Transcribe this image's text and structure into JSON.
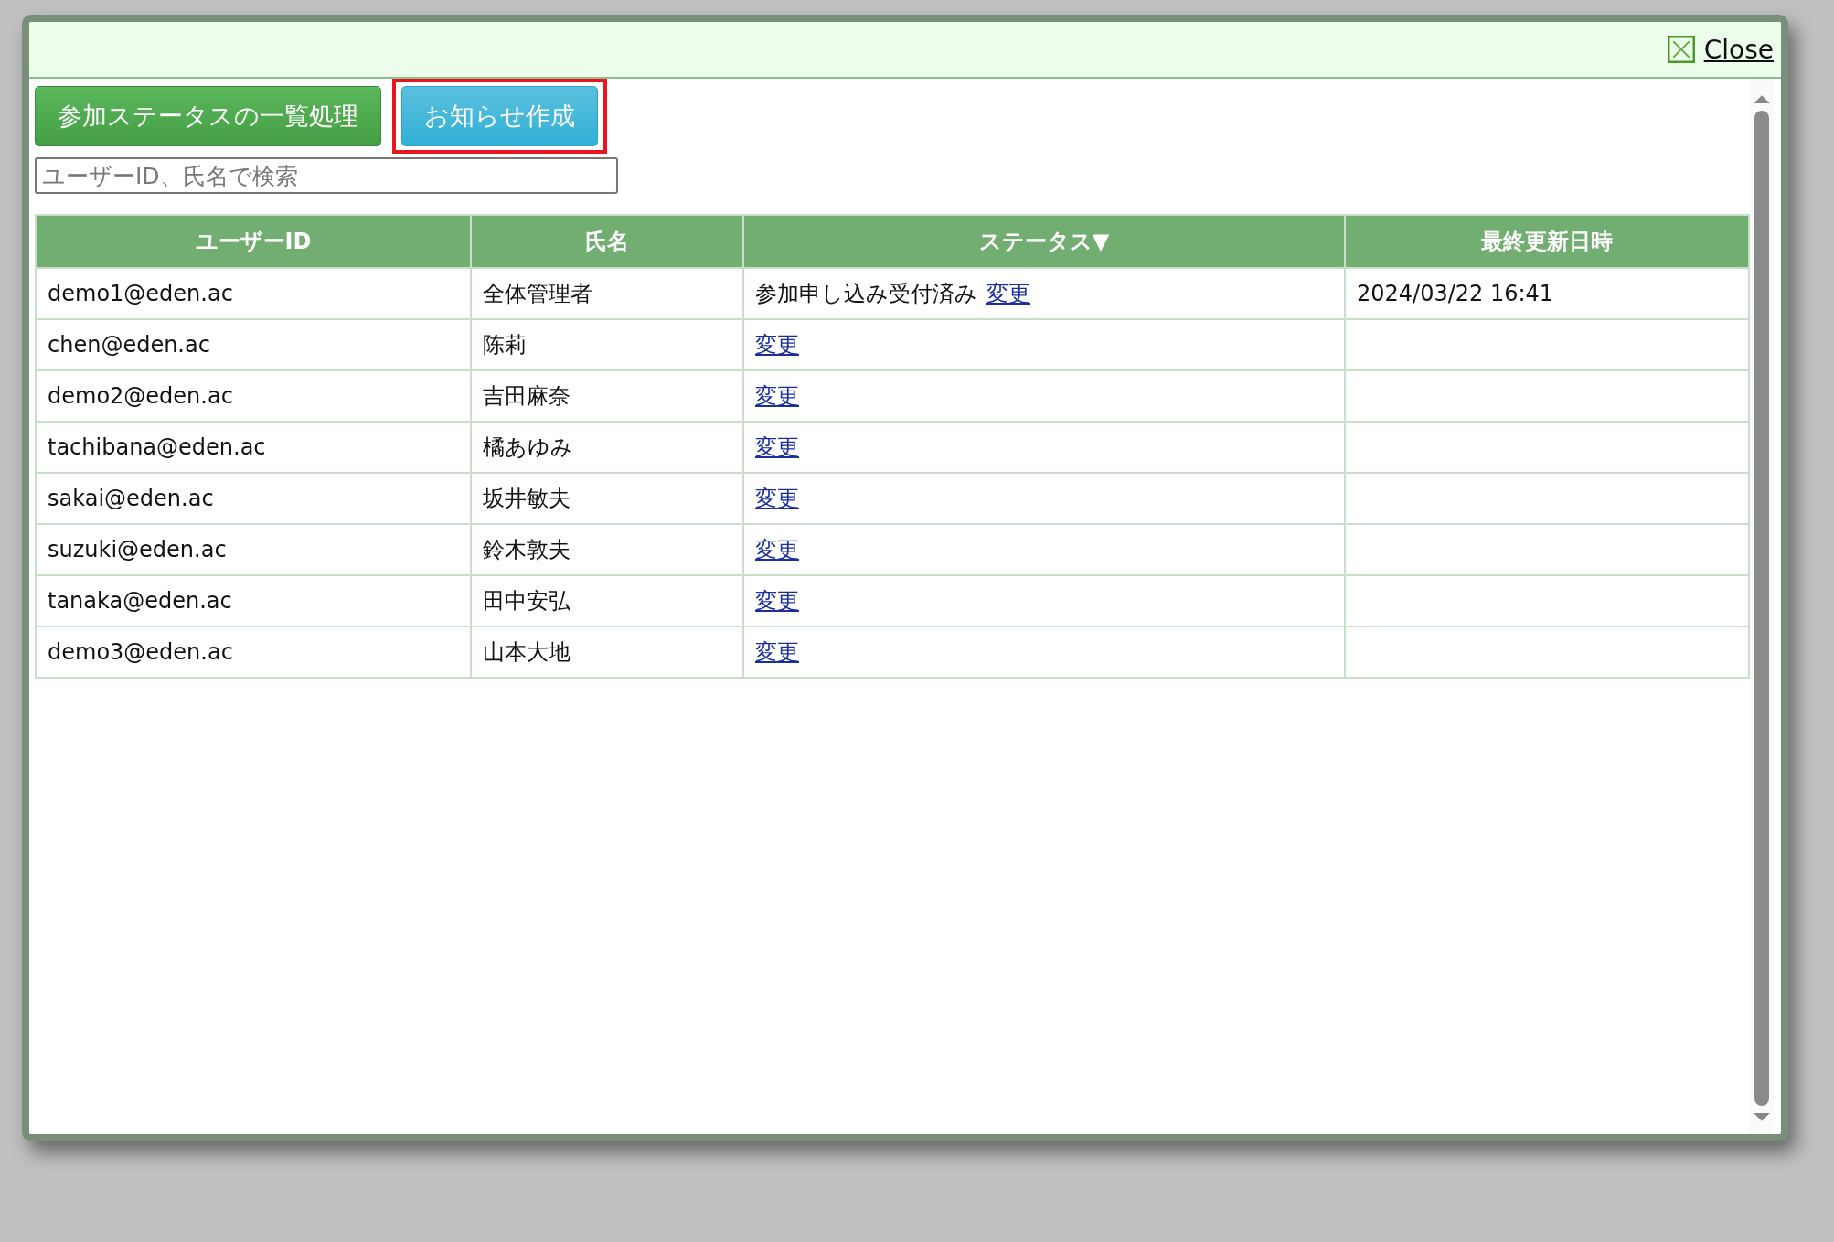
{
  "dialog": {
    "close_label": "Close"
  },
  "toolbar": {
    "buttons": [
      {
        "label": "参加ステータスの一覧処理",
        "kind": "primary",
        "highlighted": false
      },
      {
        "label": "お知らせ作成",
        "kind": "info",
        "highlighted": true
      }
    ]
  },
  "search": {
    "placeholder": "ユーザーID、氏名で検索"
  },
  "table": {
    "columns": [
      {
        "label": "ユーザーID"
      },
      {
        "label": "氏名"
      },
      {
        "label": "ステータス▼"
      },
      {
        "label": "最終更新日時"
      }
    ],
    "rows": [
      {
        "user_id": "demo1@eden.ac",
        "name": "全体管理者",
        "status": "参加申し込み受付済み",
        "action": "変更",
        "updated": "2024/03/22 16:41"
      },
      {
        "user_id": "chen@eden.ac",
        "name": "陈莉",
        "action": "変更"
      },
      {
        "user_id": "demo2@eden.ac",
        "name": "吉田麻奈",
        "action": "変更"
      },
      {
        "user_id": "tachibana@eden.ac",
        "name": "橘あゆみ",
        "action": "変更"
      },
      {
        "user_id": "sakai@eden.ac",
        "name": "坂井敏夫",
        "action": "変更"
      },
      {
        "user_id": "suzuki@eden.ac",
        "name": "鈴木敦夫",
        "action": "変更"
      },
      {
        "user_id": "tanaka@eden.ac",
        "name": "田中安弘",
        "action": "変更"
      },
      {
        "user_id": "demo3@eden.ac",
        "name": "山本大地",
        "action": "変更"
      }
    ]
  }
}
